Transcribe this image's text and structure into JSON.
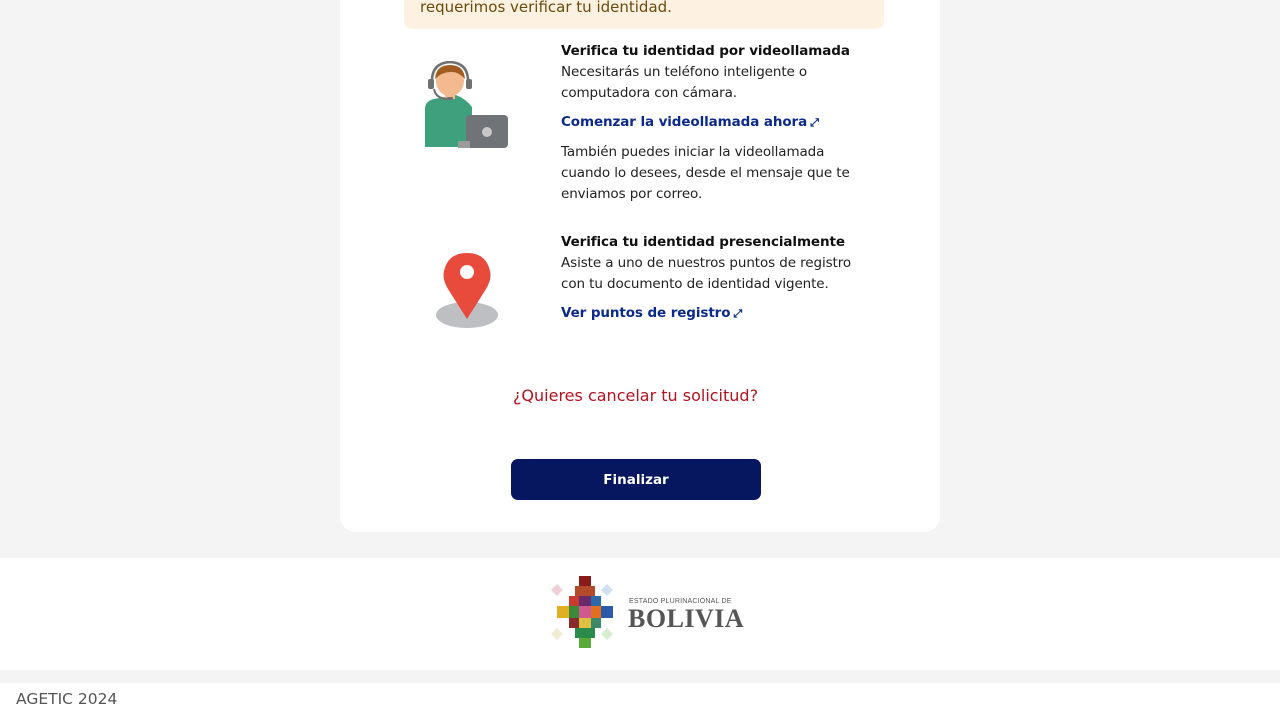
{
  "notice": {
    "text": "requerimos verificar tu identidad."
  },
  "options": [
    {
      "title": "Verifica tu identidad por videollamada",
      "description": "Necesitarás un teléfono inteligente o computadora con cámara.",
      "link": "Comenzar la videollamada ahora",
      "note": "También puedes iniciar la videollamada cuando lo desees, desde el mensaje que te enviamos por correo.",
      "icon": "video-call-agent-icon"
    },
    {
      "title": "Verifica tu identidad presencialmente",
      "description": "Asiste a uno de nuestros puntos de registro con tu documento de identidad vigente.",
      "link": "Ver puntos de registro",
      "icon": "map-pin-icon"
    }
  ],
  "external_link_icon": "⤢",
  "cancel_text": "¿Quieres cancelar tu solicitud?",
  "finalize_label": "Finalizar",
  "logo": {
    "small_text": "ESTADO PLURINACIONAL DE",
    "big_text": "BOLIVIA"
  },
  "copyright": "AGETIC 2024",
  "colors": {
    "primary_button": "#07175f",
    "link": "#0c2a8a",
    "cancel": "#b3121f",
    "notice_bg": "#fdf2e1"
  }
}
